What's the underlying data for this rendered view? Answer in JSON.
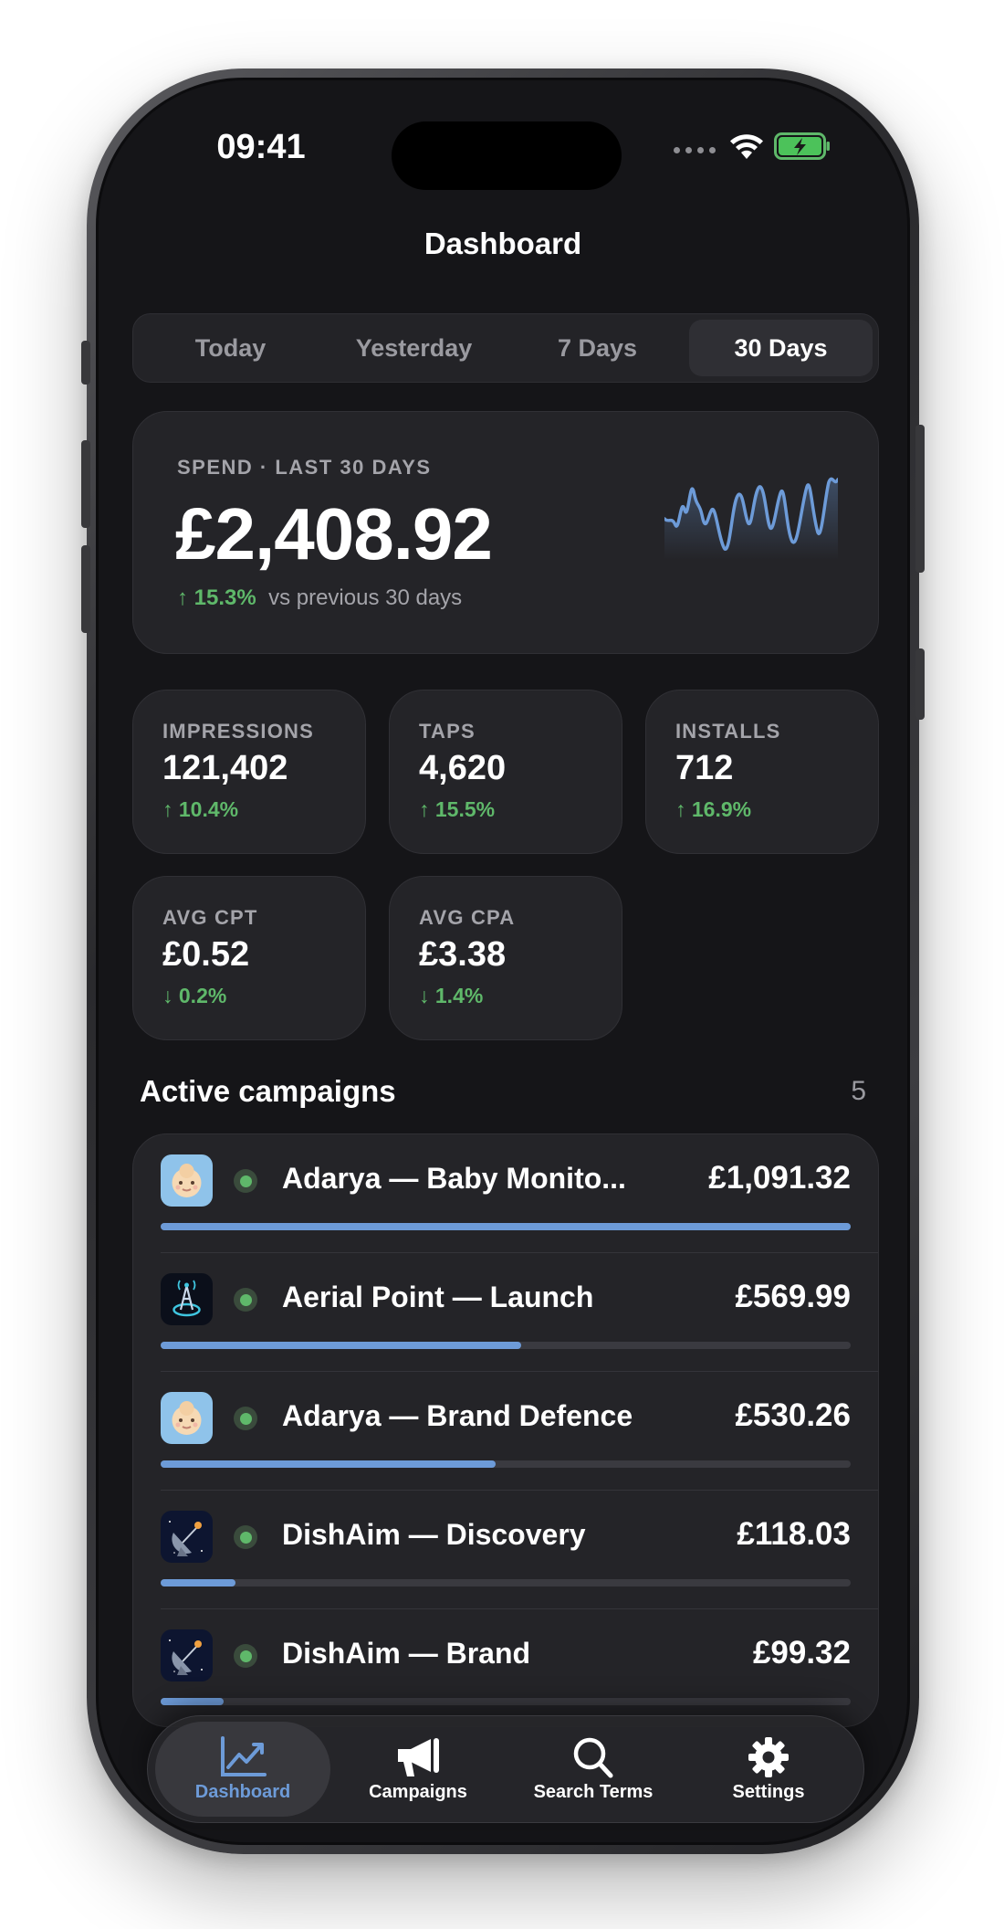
{
  "status_bar": {
    "time": "09:41"
  },
  "header": {
    "title": "Dashboard"
  },
  "segmented": {
    "options": [
      "Today",
      "Yesterday",
      "7 Days",
      "30 Days"
    ],
    "selected": "30 Days"
  },
  "spend": {
    "label": "SPEND · LAST 30 DAYS",
    "value": "£2,408.92",
    "delta": "↑ 15.3%",
    "comparison": "vs previous 30 days"
  },
  "stats": [
    {
      "label": "IMPRESSIONS",
      "value": "121,402",
      "delta": "↑ 10.4%"
    },
    {
      "label": "TAPS",
      "value": "4,620",
      "delta": "↑ 15.5%"
    },
    {
      "label": "INSTALLS",
      "value": "712",
      "delta": "↑ 16.9%"
    },
    {
      "label": "AVG CPT",
      "value": "£0.52",
      "delta": "↓ 0.2%"
    },
    {
      "label": "AVG CPA",
      "value": "£3.38",
      "delta": "↓ 1.4%"
    }
  ],
  "campaigns": {
    "title": "Active campaigns",
    "count": "5",
    "items": [
      {
        "name": "Adarya — Baby Monito...",
        "amount": "£1,091.32",
        "progress": 1.0,
        "icon": "baby-face-icon"
      },
      {
        "name": "Aerial Point — Launch",
        "amount": "£569.99",
        "progress": 0.522,
        "icon": "antenna-icon"
      },
      {
        "name": "Adarya — Brand Defence",
        "amount": "£530.26",
        "progress": 0.486,
        "icon": "baby-face-icon"
      },
      {
        "name": "DishAim — Discovery",
        "amount": "£118.03",
        "progress": 0.108,
        "icon": "satellite-dish-icon"
      },
      {
        "name": "DishAim — Brand",
        "amount": "£99.32",
        "progress": 0.091,
        "icon": "satellite-dish-icon"
      }
    ]
  },
  "tab_bar": {
    "items": [
      {
        "label": "Dashboard",
        "icon": "chart-line-icon"
      },
      {
        "label": "Campaigns",
        "icon": "megaphone-icon"
      },
      {
        "label": "Search Terms",
        "icon": "search-icon"
      },
      {
        "label": "Settings",
        "icon": "gear-icon"
      }
    ],
    "selected": "Dashboard"
  },
  "colors": {
    "accent": "#6d9bd8",
    "positive": "#5fb86a",
    "background": "#151518",
    "card": "#242428"
  }
}
